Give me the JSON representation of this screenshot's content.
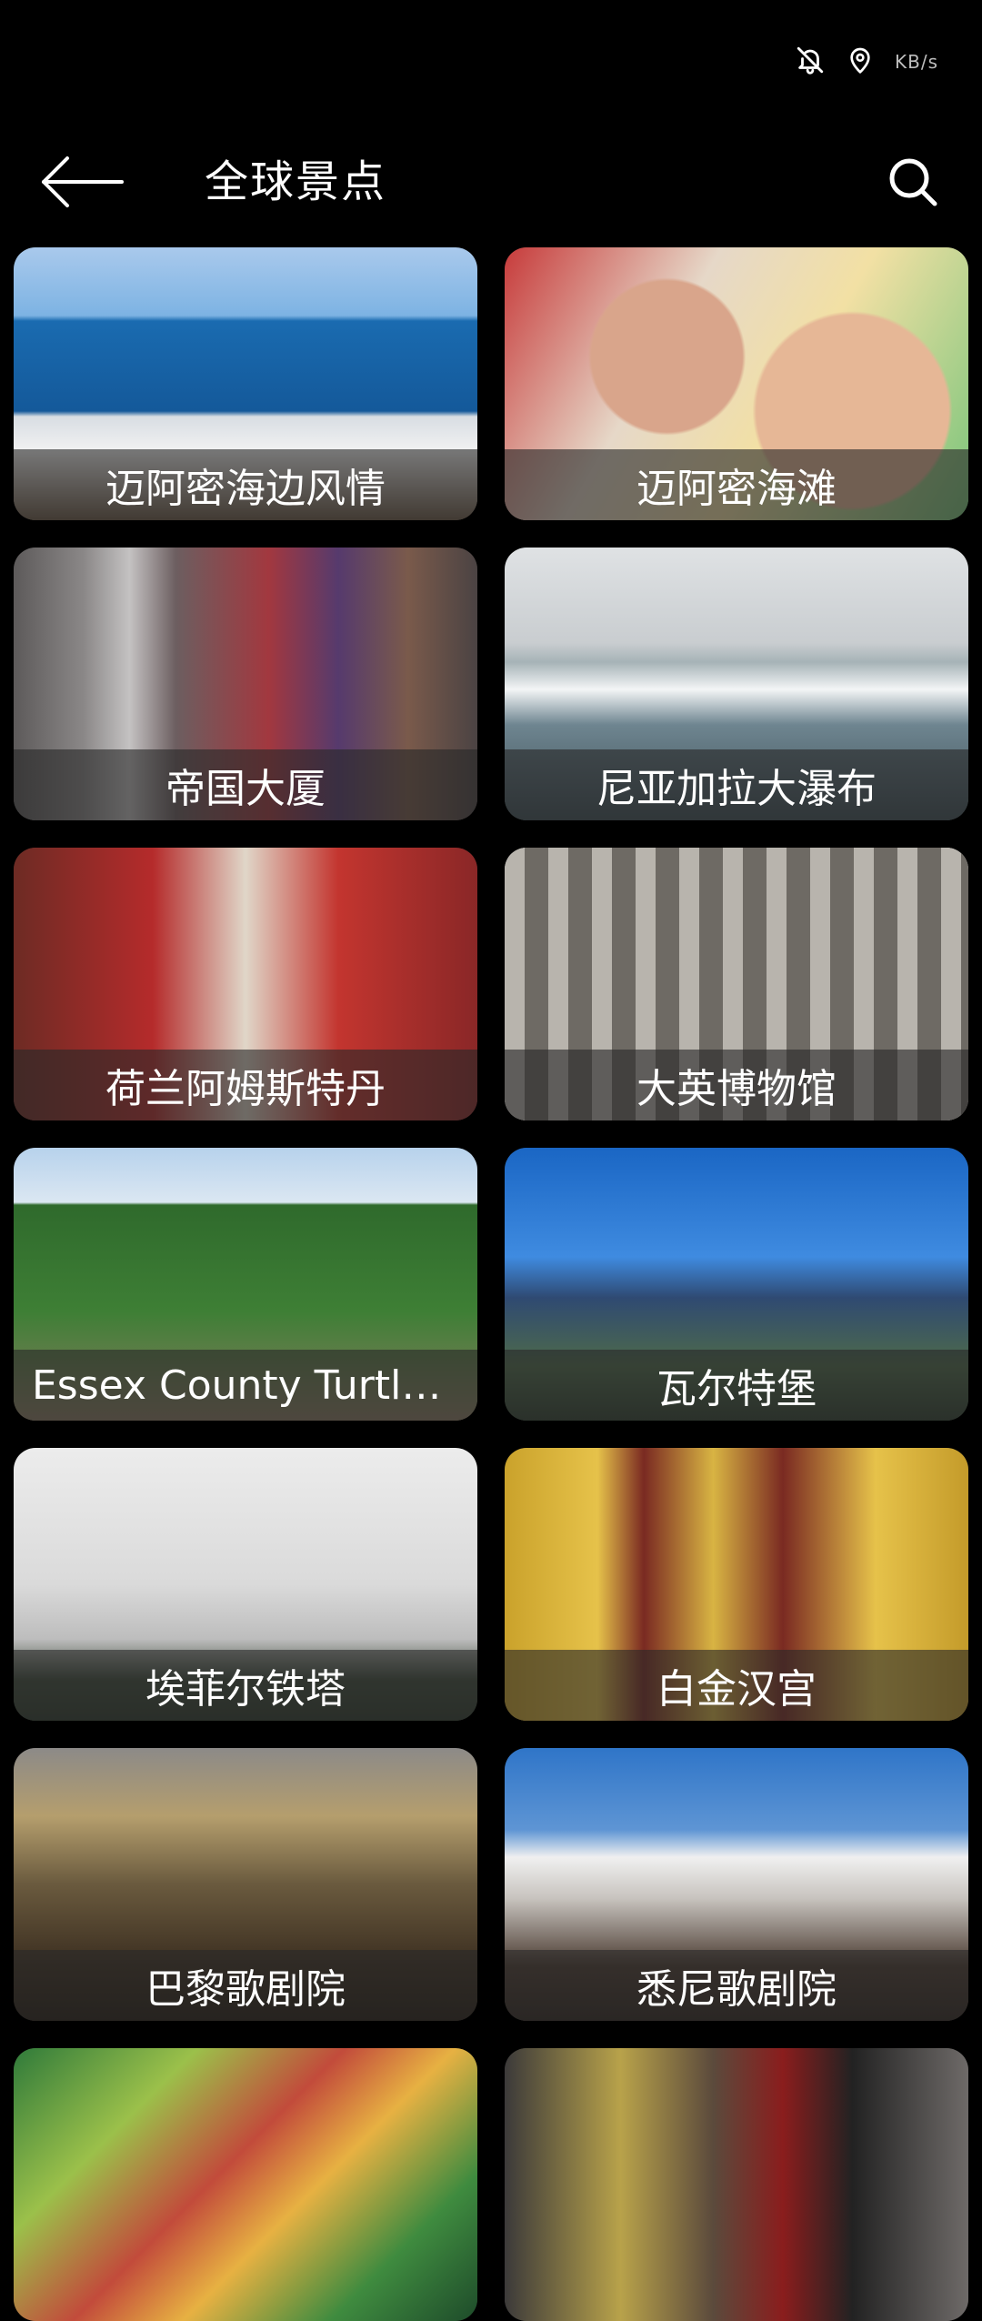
{
  "app_bar": {
    "title": "全球景点"
  },
  "status_bar": {
    "right_text": "KB/s"
  },
  "grid": {
    "items": [
      {
        "label": "迈阿密海边风情"
      },
      {
        "label": "迈阿密海滩"
      },
      {
        "label": "帝国大厦"
      },
      {
        "label": "尼亚加拉大瀑布"
      },
      {
        "label": "荷兰阿姆斯特丹"
      },
      {
        "label": "大英博物馆"
      },
      {
        "label": "Essex County Turtle Ba..."
      },
      {
        "label": "瓦尔特堡"
      },
      {
        "label": "埃菲尔铁塔"
      },
      {
        "label": "白金汉宫"
      },
      {
        "label": "巴黎歌剧院"
      },
      {
        "label": "悉尼歌剧院"
      },
      {
        "label": ""
      },
      {
        "label": ""
      }
    ]
  },
  "icons": {
    "back": "back-arrow-icon",
    "search": "search-icon",
    "mute": "bell-muted-icon",
    "location": "location-pin-icon"
  }
}
